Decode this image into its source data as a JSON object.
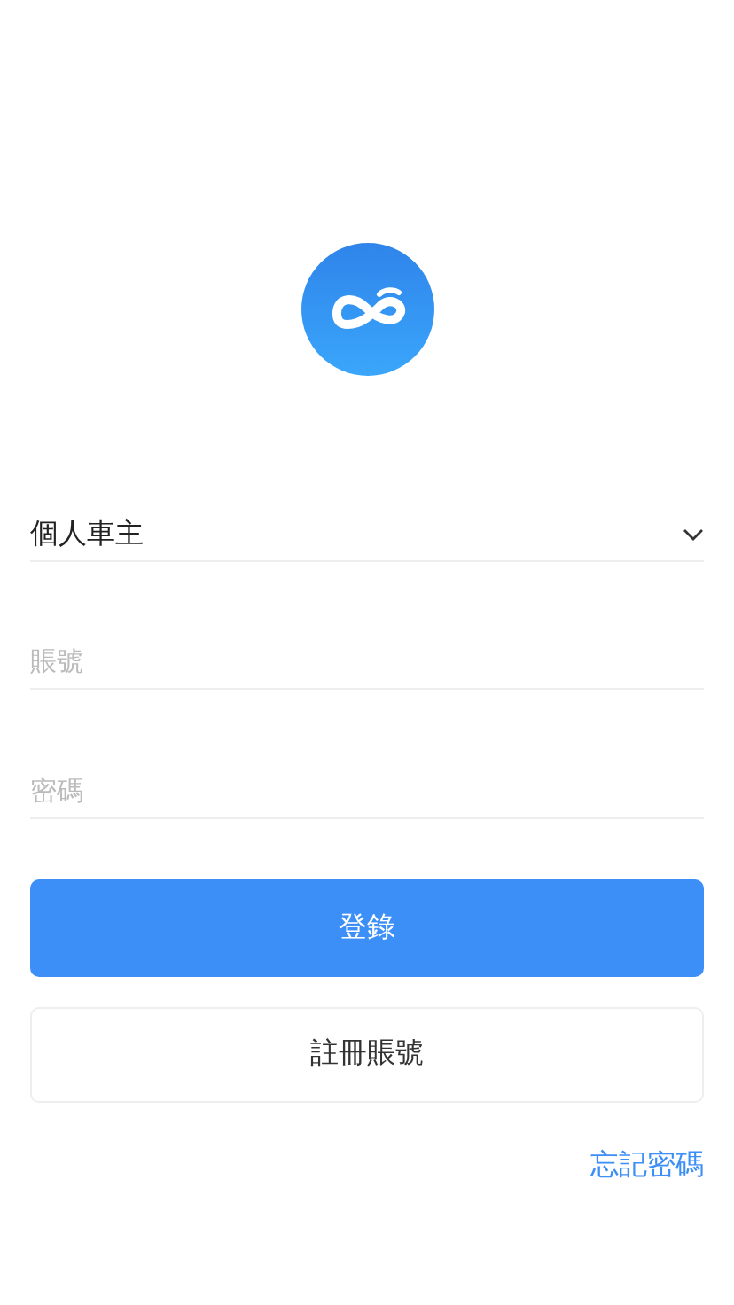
{
  "role_select": {
    "value": "個人車主"
  },
  "account_field": {
    "placeholder": "賬號"
  },
  "password_field": {
    "placeholder": "密碼"
  },
  "login_button": {
    "label": "登錄"
  },
  "register_button": {
    "label": "註冊賬號"
  },
  "forgot_password_link": {
    "label": "忘記密碼"
  }
}
